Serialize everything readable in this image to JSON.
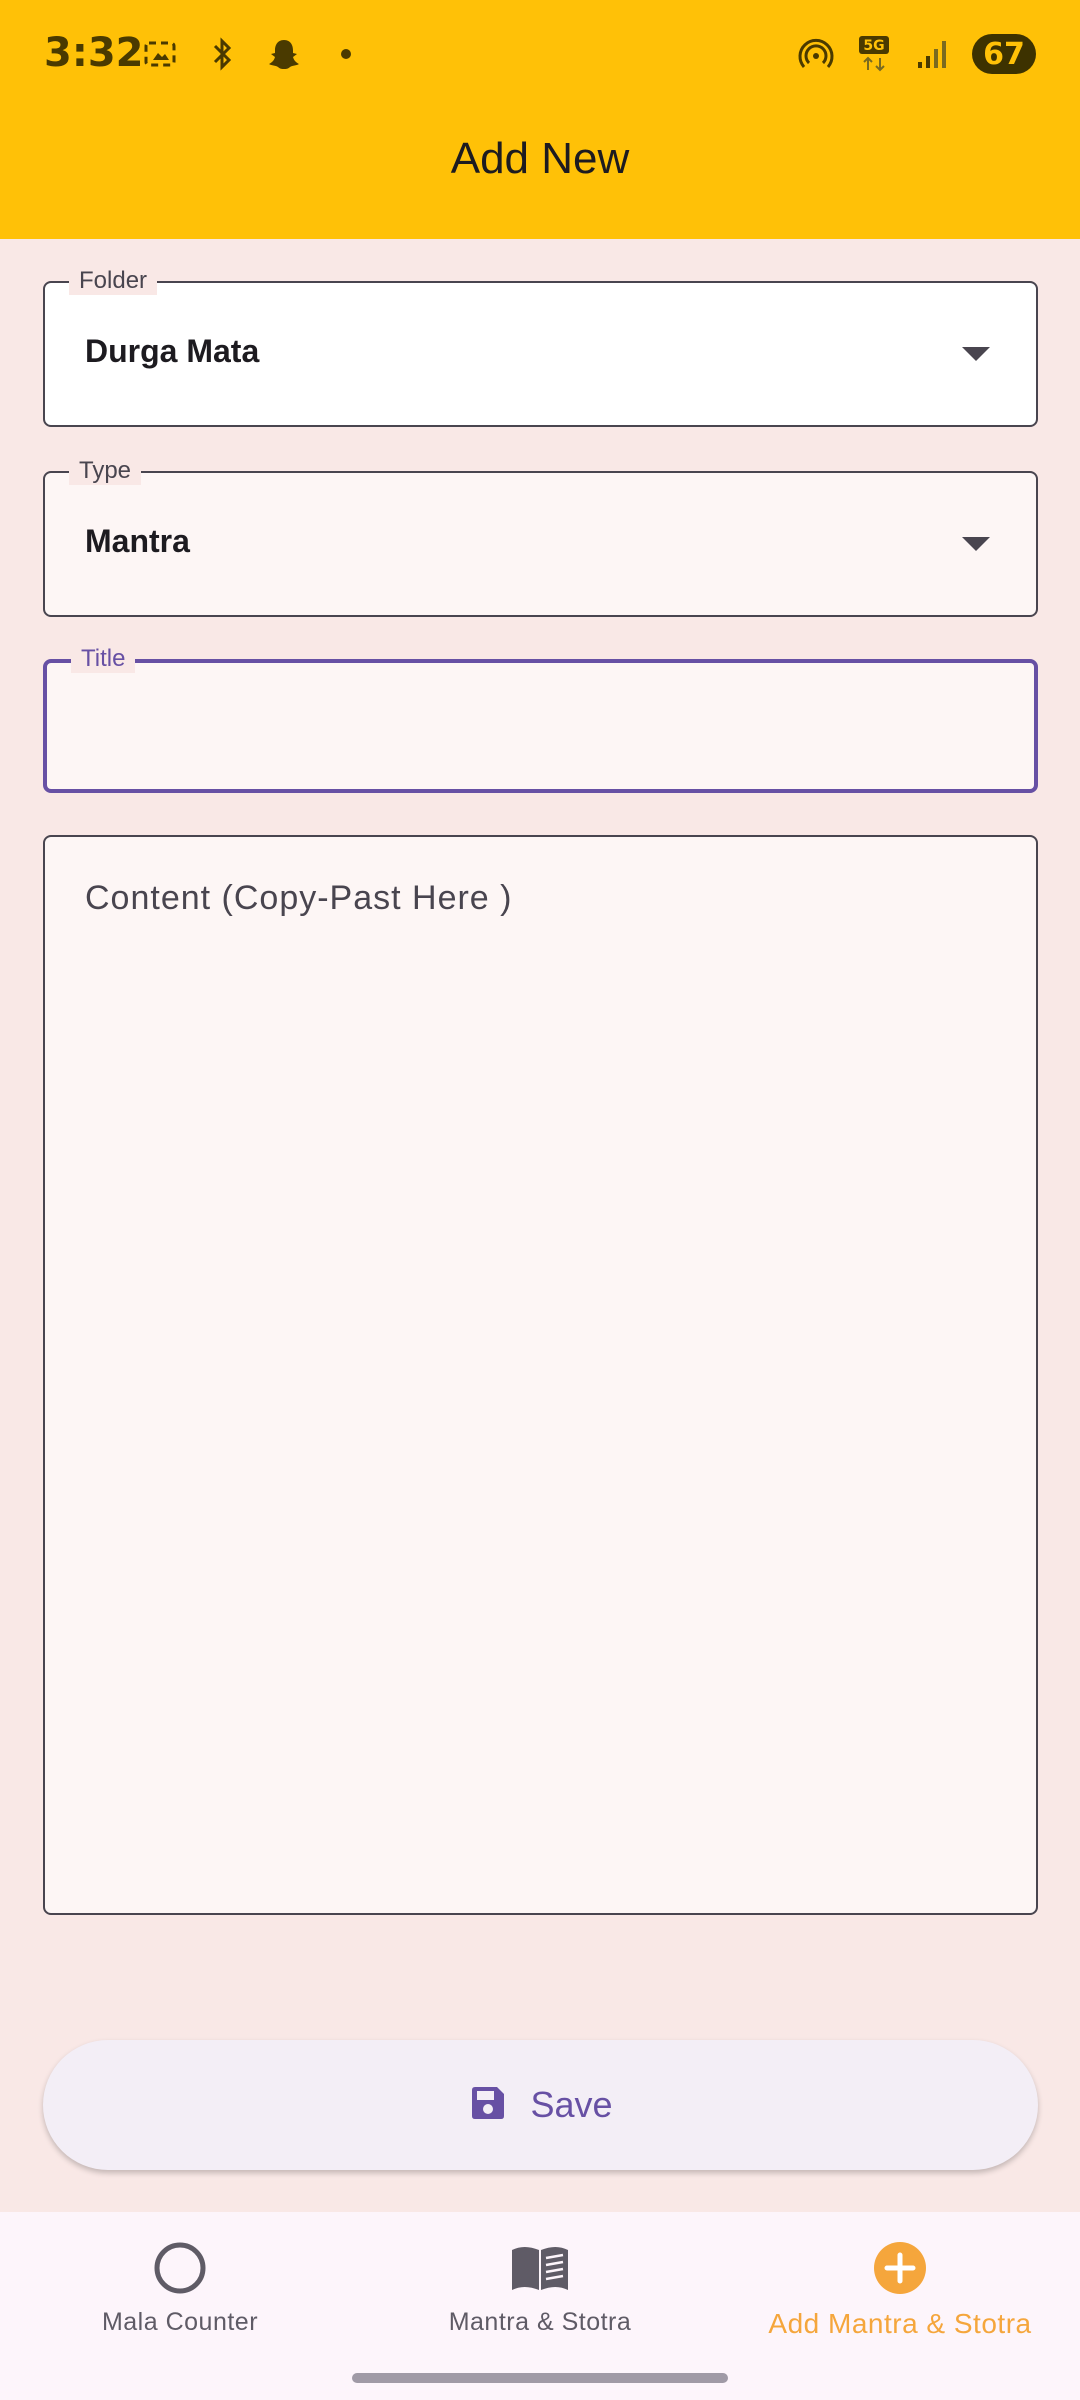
{
  "status_bar": {
    "time": "3:32",
    "battery": "67",
    "left_icons": [
      "screenshot-icon",
      "bluetooth-icon",
      "snapchat-icon",
      "dot-icon"
    ],
    "right_icons": [
      "hotspot-icon",
      "5g-icon",
      "signal-icon",
      "battery-icon"
    ]
  },
  "app_bar": {
    "title": "Add New"
  },
  "form": {
    "folder": {
      "label": "Folder",
      "value": "Durga Mata"
    },
    "type": {
      "label": "Type",
      "value": "Mantra"
    },
    "title": {
      "label": "Title",
      "value": ""
    },
    "content": {
      "placeholder": "Content (Copy-Past Here )"
    }
  },
  "save_button": {
    "label": "Save"
  },
  "bottom_nav": {
    "items": [
      {
        "label": "Mala Counter",
        "icon": "circle-icon",
        "active": false
      },
      {
        "label": "Mantra & Stotra",
        "icon": "book-icon",
        "active": false
      },
      {
        "label": "Add Mantra & Stotra",
        "icon": "add-circle-icon",
        "active": true
      }
    ]
  },
  "colors": {
    "app_bar": "#ffc107",
    "background": "#f9e8e6",
    "accent": "#6750a4",
    "active_nav": "#f5a63c"
  }
}
